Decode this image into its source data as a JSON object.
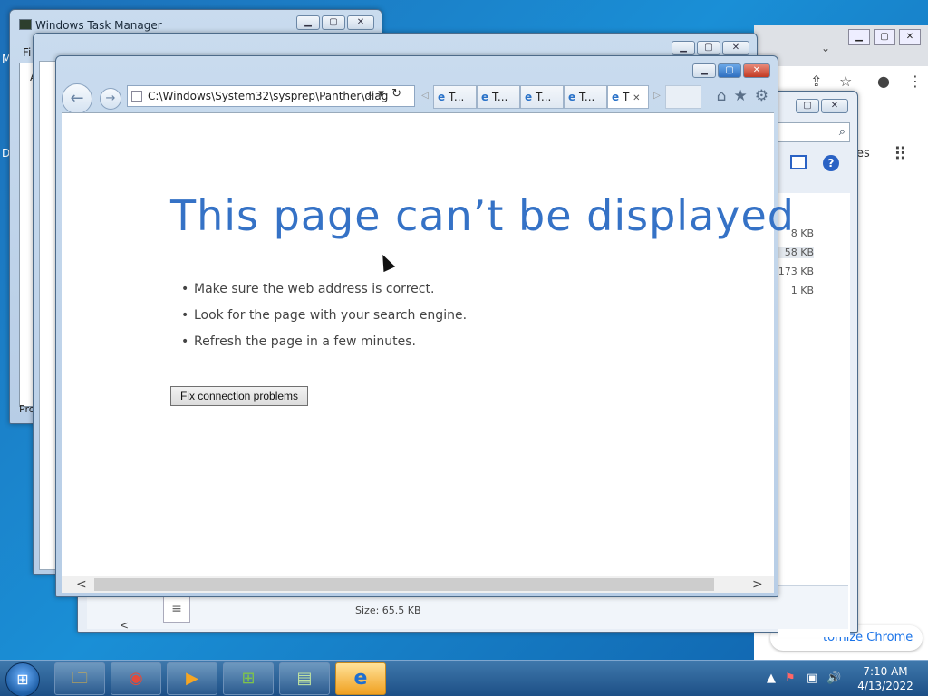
{
  "task_manager": {
    "title": "Windows Task Manager",
    "menu_fragment": "Fi",
    "tab_fragment": "A",
    "status_fragment": "Pro",
    "caption_min": "▁",
    "caption_max": "▢",
    "caption_close": "✕"
  },
  "desktop_fragments": {
    "left_letter_m": "M",
    "left_letter_d": "D"
  },
  "chrome": {
    "apps_label_fragment": "es",
    "customize_label": "tomize Chrome",
    "chevron": "⌄",
    "share_icon": "⇪",
    "star_icon": "☆",
    "account_icon": "●",
    "menu_icon": "⋮",
    "grid_icon": "⠿"
  },
  "explorer": {
    "search_icon": "⌕",
    "help_label": "?",
    "file_sizes": [
      "8 KB",
      "58 KB",
      "173 KB",
      "1 KB"
    ],
    "details_size_label": "Size:",
    "details_size_value": "65.5 KB",
    "scroll_left": "<"
  },
  "ie": {
    "back_icon": "←",
    "forward_icon": "→",
    "address": "C:\\Windows\\System32\\sysprep\\Panther\\diag",
    "search_icon": "⌕",
    "dropdown_icon": "▾",
    "refresh_icon": "↻",
    "tab_left": "◁",
    "tab_right": "▷",
    "tabs": [
      {
        "icon": "e",
        "label": "T..."
      },
      {
        "icon": "e",
        "label": "T..."
      },
      {
        "icon": "e",
        "label": "T..."
      },
      {
        "icon": "e",
        "label": "T..."
      },
      {
        "icon": "e",
        "label": "T",
        "close": "✕"
      }
    ],
    "home_icon": "⌂",
    "favorites_icon": "★",
    "tools_icon": "⚙",
    "heading": "This page can’t be displayed",
    "bullets": [
      "Make sure the web address is correct.",
      "Look for the page with your search engine.",
      "Refresh the page in a few minutes."
    ],
    "fix_button": "Fix connection problems",
    "scroll_left": "<",
    "scroll_right": ">"
  },
  "taskbar": {
    "start_icon": "⊞",
    "apps": [
      {
        "name": "explorer",
        "icon": "🗀"
      },
      {
        "name": "chrome",
        "icon": "◉"
      },
      {
        "name": "media-player",
        "icon": "▶"
      },
      {
        "name": "windows-update",
        "icon": "⊞"
      },
      {
        "name": "task-manager",
        "icon": "▤"
      },
      {
        "name": "internet-explorer",
        "icon": "e"
      }
    ],
    "tray_arrow": "▲",
    "tray_flag": "⚑",
    "tray_network": "▣",
    "tray_volume": "🔊",
    "time": "7:10 AM",
    "date": "4/13/2022"
  }
}
